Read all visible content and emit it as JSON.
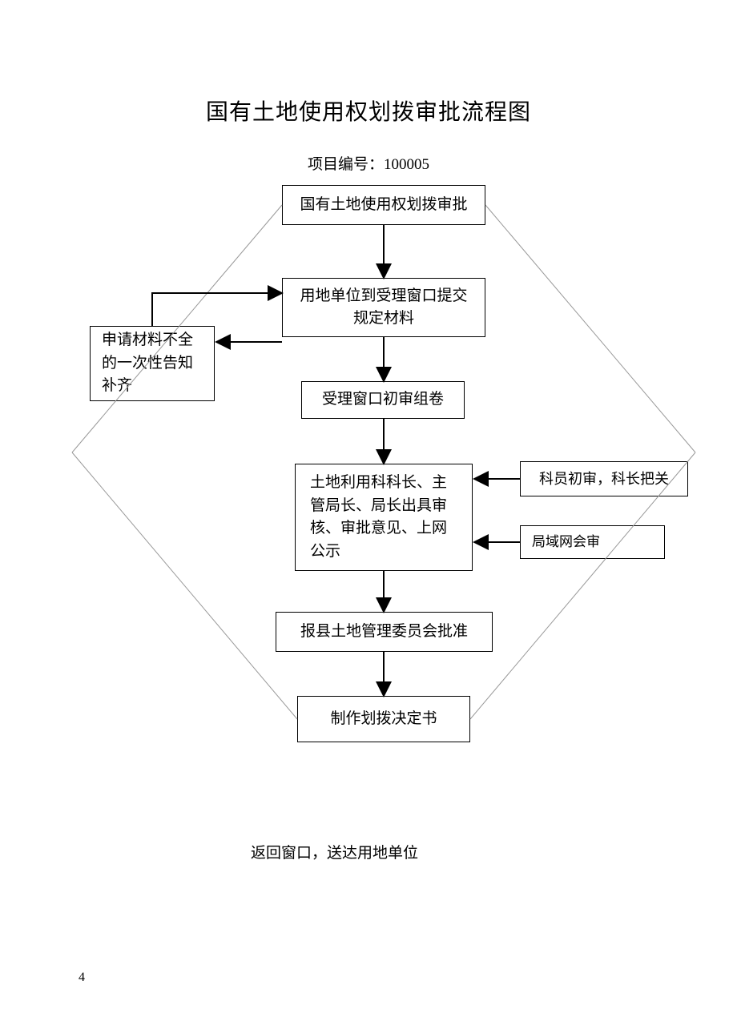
{
  "title": "国有土地使用权划拨审批流程图",
  "subtitle": "项目编号：100005",
  "nodes": {
    "n1": "国有土地使用权划拨审批",
    "n2": "用地单位到受理窗口提交\n规定材料",
    "n3": "受理窗口初审组卷",
    "n4": "土地利用科科长、主管局长、局长出具审核、审批意见、上网公示",
    "n5": "报县土地管理委员会批准",
    "n6": "制作划拨决定书",
    "side_left": "申请材料不全的一次性告知补齐",
    "side_r1": "科员初审，科长把关",
    "side_r2": "局域网会审"
  },
  "footer": "返回窗口，送达用地单位",
  "page_number": "4"
}
